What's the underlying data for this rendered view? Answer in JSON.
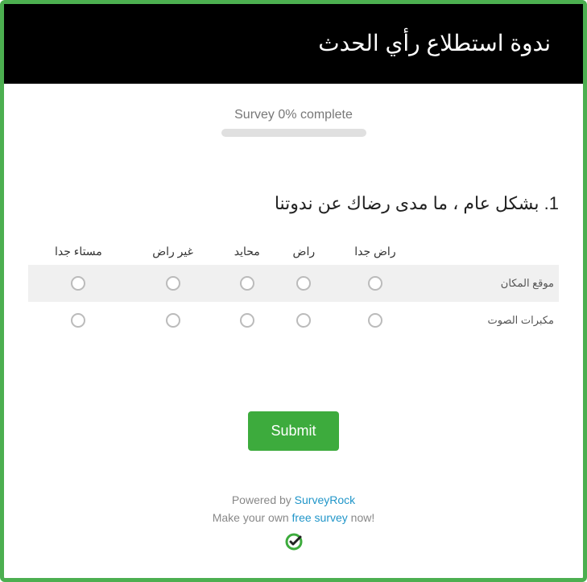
{
  "header": {
    "title": "ندوة استطلاع رأي الحدث"
  },
  "progress": {
    "label": "Survey 0% complete"
  },
  "question": {
    "text": "1. بشكل عام ، ما مدى رضاك عن ندوتنا",
    "columns": [
      "مستاء جدا",
      "غير راض",
      "محايد",
      "راض",
      "راض جدا"
    ],
    "rows": [
      {
        "label": "موقع المكان"
      },
      {
        "label": "مكبرات الصوت"
      }
    ]
  },
  "submit": {
    "label": "Submit"
  },
  "footer": {
    "powered_pre": "Powered by ",
    "powered_link": "SurveyRock",
    "make_pre": "Make your own ",
    "make_link": "free survey",
    "make_post": " now!"
  }
}
